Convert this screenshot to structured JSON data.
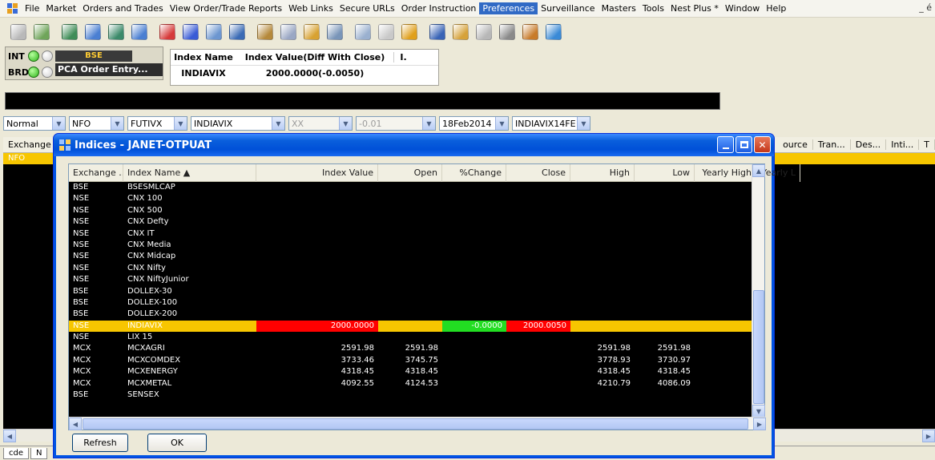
{
  "menu": {
    "items": [
      {
        "label": "File"
      },
      {
        "label": "Market"
      },
      {
        "label": "Orders and Trades"
      },
      {
        "label": "View Order/Trade Reports"
      },
      {
        "label": "Web Links"
      },
      {
        "label": "Secure URLs"
      },
      {
        "label": "Order Instruction"
      },
      {
        "label": "Preferences",
        "active": true
      },
      {
        "label": "Surveillance"
      },
      {
        "label": "Masters"
      },
      {
        "label": "Tools"
      },
      {
        "label": "Nest Plus *"
      },
      {
        "label": "Window"
      },
      {
        "label": "Help"
      }
    ],
    "window_controls": "_ é"
  },
  "toolbar": {
    "icons": [
      {
        "name": "rupee-icon",
        "color": "#b9b9b9"
      },
      {
        "name": "connect-icon",
        "color": "#6fa55a"
      },
      {
        "name": "market-watch-icon",
        "color": "#3f8d57"
      },
      {
        "name": "order-book-icon",
        "color": "#4a7fd2"
      },
      {
        "name": "trade-book-icon",
        "color": "#3c8a6a"
      },
      {
        "name": "window-icon",
        "color": "#4a7fd2"
      },
      {
        "name": "buy-order-icon",
        "color": "#d63a3a"
      },
      {
        "name": "sell-order-icon",
        "color": "#3a5cd6"
      },
      {
        "name": "net-position-icon",
        "color": "#6c96d0"
      },
      {
        "name": "user-icon",
        "color": "#3b6bb5"
      },
      {
        "name": "pen-icon",
        "color": "#b5893b"
      },
      {
        "name": "snapshot-icon",
        "color": "#9aa7c4"
      },
      {
        "name": "report-icon",
        "color": "#d8a232"
      },
      {
        "name": "calculator-icon",
        "color": "#7995b8"
      },
      {
        "name": "notes-icon",
        "color": "#9ab0cf"
      },
      {
        "name": "blank-icon",
        "color": "#c9c9c9"
      },
      {
        "name": "chart-icon",
        "color": "#e0a01c"
      },
      {
        "name": "refresh-icon",
        "color": "#3a64b6"
      },
      {
        "name": "export-icon",
        "color": "#d6a23a"
      },
      {
        "name": "message-icon",
        "color": "#b7b7b7"
      },
      {
        "name": "print-icon",
        "color": "#8a8a8a"
      },
      {
        "name": "tools-icon",
        "color": "#c87b2a"
      },
      {
        "name": "info-icon",
        "color": "#3a8ad6"
      }
    ]
  },
  "status": {
    "int_label": "INT",
    "brd_label": "BRD",
    "exchange_tag": "BSE",
    "pca_label": "PCA Order Entry..."
  },
  "index_panel": {
    "headers": [
      "Index Name",
      "Index Value(Diff With Close)",
      "I."
    ],
    "row": {
      "name": "INDIAVIX",
      "value": "2000.0000(-0.0050)"
    }
  },
  "selectors": {
    "product": "Normal",
    "exchange": "NFO",
    "instrument": "FUTIVX",
    "symbol": "INDIAVIX",
    "option_type": "XX",
    "strike": "-0.01",
    "expiry": "18Feb2014",
    "contract": "INDIAVIX14FE"
  },
  "background_grid": {
    "headers_left": [
      "Exchange"
    ],
    "headers_right": [
      "ource",
      "Tran...",
      "Des...",
      "Inti...",
      "T"
    ],
    "yellow_row_text": "NFO",
    "bottom_tabs": [
      "cde",
      "N"
    ]
  },
  "dialog": {
    "title": "Indices - JANET-OTPUAT",
    "columns": [
      {
        "label": "Exchange ...",
        "align": "left"
      },
      {
        "label": "Index Name  ▲",
        "align": "left"
      },
      {
        "label": "Index Value",
        "align": "right"
      },
      {
        "label": "Open",
        "align": "right"
      },
      {
        "label": "%Change",
        "align": "right"
      },
      {
        "label": "Close",
        "align": "right"
      },
      {
        "label": "High",
        "align": "right"
      },
      {
        "label": "Low",
        "align": "right"
      },
      {
        "label": "Yearly High",
        "align": "right"
      },
      {
        "label": "Yearly L",
        "align": "right"
      }
    ],
    "rows": [
      [
        "BSE",
        "BSESMLCAP",
        "",
        "",
        "",
        "",
        "",
        "",
        "",
        ""
      ],
      [
        "NSE",
        "CNX 100",
        "",
        "",
        "",
        "",
        "",
        "",
        "",
        ""
      ],
      [
        "NSE",
        "CNX 500",
        "",
        "",
        "",
        "",
        "",
        "",
        "",
        ""
      ],
      [
        "NSE",
        "CNX Defty",
        "",
        "",
        "",
        "",
        "",
        "",
        "",
        ""
      ],
      [
        "NSE",
        "CNX IT",
        "",
        "",
        "",
        "",
        "",
        "",
        "",
        ""
      ],
      [
        "NSE",
        "CNX Media",
        "",
        "",
        "",
        "",
        "",
        "",
        "",
        ""
      ],
      [
        "NSE",
        "CNX Midcap",
        "",
        "",
        "",
        "",
        "",
        "",
        "",
        ""
      ],
      [
        "NSE",
        "CNX Nifty",
        "",
        "",
        "",
        "",
        "",
        "",
        "",
        ""
      ],
      [
        "NSE",
        "CNX NiftyJunior",
        "",
        "",
        "",
        "",
        "",
        "",
        "",
        ""
      ],
      [
        "BSE",
        "DOLLEX-30",
        "",
        "",
        "",
        "",
        "",
        "",
        "",
        ""
      ],
      [
        "BSE",
        "DOLLEX-100",
        "",
        "",
        "",
        "",
        "",
        "",
        "",
        ""
      ],
      [
        "BSE",
        "DOLLEX-200",
        "",
        "",
        "",
        "",
        "",
        "",
        "",
        ""
      ],
      [
        "NSE",
        "INDIAVIX",
        "2000.0000",
        "",
        "-0.0000",
        "2000.0050",
        "",
        "",
        "",
        ""
      ],
      [
        "NSE",
        "LIX 15",
        "",
        "",
        "",
        "",
        "",
        "",
        "",
        ""
      ],
      [
        "MCX",
        "MCXAGRI",
        "2591.98",
        "2591.98",
        "",
        "",
        "2591.98",
        "2591.98",
        "",
        ""
      ],
      [
        "MCX",
        "MCXCOMDEX",
        "3733.46",
        "3745.75",
        "",
        "",
        "3778.93",
        "3730.97",
        "",
        ""
      ],
      [
        "MCX",
        "MCXENERGY",
        "4318.45",
        "4318.45",
        "",
        "",
        "4318.45",
        "4318.45",
        "",
        ""
      ],
      [
        "MCX",
        "MCXMETAL",
        "4092.55",
        "4124.53",
        "",
        "",
        "4210.79",
        "4086.09",
        "",
        ""
      ],
      [
        "BSE",
        "SENSEX",
        "",
        "",
        "",
        "",
        "",
        "",
        "",
        ""
      ]
    ],
    "highlight_row": 12,
    "highlight_colors": {
      "row": "#f7c600",
      "index_value": "#ff0000",
      "pct_change": "#22dd22",
      "close": "#ff0000"
    },
    "buttons": {
      "refresh": "Refresh",
      "ok": "OK"
    }
  }
}
